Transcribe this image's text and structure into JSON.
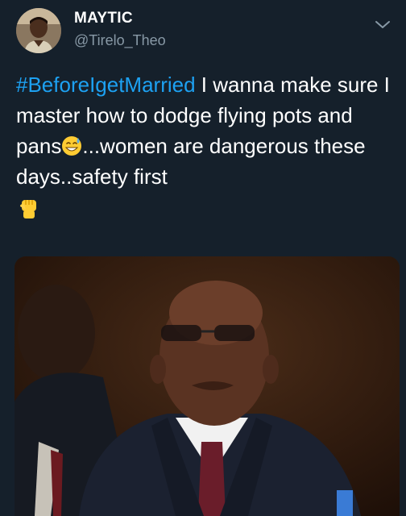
{
  "author": {
    "display_name": "MAYTIC",
    "handle": "@Tirelo_Theo",
    "avatar_icon": "person-avatar"
  },
  "tweet": {
    "hashtag": "#BeforeIgetMarried",
    "text_part1": " I wanna make sure I master how to dodge flying pots and pans",
    "text_part2": "...women are dangerous these days..safety first",
    "emoji_1": "grinning-face-with-sweat-icon",
    "emoji_2": "raised-fist-icon"
  },
  "menu": {
    "icon": "chevron-down-icon"
  },
  "colors": {
    "background": "#15202b",
    "text": "#ffffff",
    "secondary_text": "#8899a6",
    "link": "#1da1f2"
  }
}
